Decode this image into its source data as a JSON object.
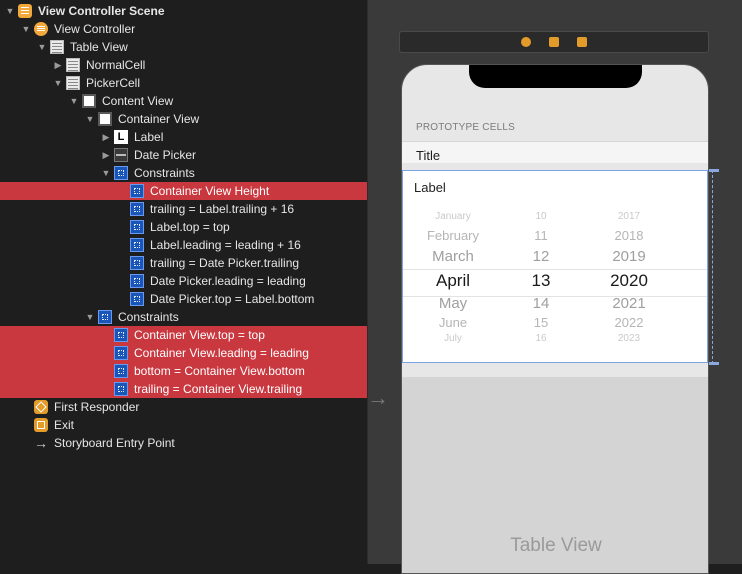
{
  "outline": {
    "rows": [
      {
        "level": 0,
        "disc": "open",
        "icon": "scene",
        "icon_name": "scene-icon",
        "label": "View Controller Scene",
        "bold": true,
        "selected": false
      },
      {
        "level": 1,
        "disc": "open",
        "icon": "vc",
        "icon_name": "view-controller-icon",
        "label": "View Controller",
        "selected": false
      },
      {
        "level": 2,
        "disc": "open",
        "icon": "table",
        "icon_name": "table-view-icon",
        "label": "Table View",
        "selected": false
      },
      {
        "level": 3,
        "disc": "closed",
        "icon": "table",
        "icon_name": "table-cell-icon",
        "label": "NormalCell",
        "selected": false
      },
      {
        "level": 3,
        "disc": "open",
        "icon": "table",
        "icon_name": "table-cell-icon",
        "label": "PickerCell",
        "selected": false
      },
      {
        "level": 4,
        "disc": "open",
        "icon": "view",
        "icon_name": "view-icon",
        "label": "Content View",
        "selected": false
      },
      {
        "level": 5,
        "disc": "open",
        "icon": "view",
        "icon_name": "view-icon",
        "label": "Container View",
        "selected": false
      },
      {
        "level": 6,
        "disc": "closed",
        "icon": "label",
        "icon_name": "label-icon",
        "icon_text": "L",
        "label": "Label",
        "selected": false
      },
      {
        "level": 6,
        "disc": "closed",
        "icon": "picker",
        "icon_name": "date-picker-icon",
        "label": "Date Picker",
        "selected": false
      },
      {
        "level": 6,
        "disc": "open",
        "icon": "cons",
        "icon_name": "constraints-icon",
        "label": "Constraints",
        "selected": false
      },
      {
        "level": 7,
        "disc": "none",
        "icon": "cons",
        "icon_name": "constraint-icon",
        "label": "Container View Height",
        "selected": true
      },
      {
        "level": 7,
        "disc": "none",
        "icon": "cons",
        "icon_name": "constraint-icon",
        "label": "trailing = Label.trailing + 16",
        "selected": false
      },
      {
        "level": 7,
        "disc": "none",
        "icon": "cons",
        "icon_name": "constraint-icon",
        "label": "Label.top = top",
        "selected": false
      },
      {
        "level": 7,
        "disc": "none",
        "icon": "cons",
        "icon_name": "constraint-icon",
        "label": "Label.leading = leading + 16",
        "selected": false
      },
      {
        "level": 7,
        "disc": "none",
        "icon": "cons",
        "icon_name": "constraint-icon",
        "label": "trailing = Date Picker.trailing",
        "selected": false
      },
      {
        "level": 7,
        "disc": "none",
        "icon": "cons",
        "icon_name": "constraint-icon",
        "label": "Date Picker.leading = leading",
        "selected": false
      },
      {
        "level": 7,
        "disc": "none",
        "icon": "cons",
        "icon_name": "constraint-icon",
        "label": "Date Picker.top = Label.bottom",
        "selected": false
      },
      {
        "level": 5,
        "disc": "open",
        "icon": "cons",
        "icon_name": "constraints-icon",
        "label": "Constraints",
        "selected": false
      },
      {
        "level": 6,
        "disc": "none",
        "icon": "cons",
        "icon_name": "constraint-icon",
        "label": "Container View.top = top",
        "selected": true
      },
      {
        "level": 6,
        "disc": "none",
        "icon": "cons",
        "icon_name": "constraint-icon",
        "label": "Container View.leading = leading",
        "selected": true
      },
      {
        "level": 6,
        "disc": "none",
        "icon": "cons",
        "icon_name": "constraint-icon",
        "label": "bottom = Container View.bottom",
        "selected": true
      },
      {
        "level": 6,
        "disc": "none",
        "icon": "cons",
        "icon_name": "constraint-icon",
        "label": "trailing = Container View.trailing",
        "selected": true
      },
      {
        "level": 1,
        "disc": "none",
        "icon": "first",
        "icon_name": "first-responder-icon",
        "label": "First Responder",
        "selected": false
      },
      {
        "level": 1,
        "disc": "none",
        "icon": "exit",
        "icon_name": "exit-icon",
        "label": "Exit",
        "selected": false
      },
      {
        "level": 1,
        "disc": "none",
        "icon": "arrow",
        "icon_name": "entry-point-arrow-icon",
        "icon_text": "→",
        "label": "Storyboard Entry Point",
        "selected": false
      }
    ]
  },
  "canvas": {
    "prototype_header": "PROTOTYPE CELLS",
    "title_cell": "Title",
    "picker_cell_label": "Label",
    "picker": [
      {
        "month": "January",
        "day": "10",
        "year": "2017",
        "size": 10,
        "color": "#c9c9c9"
      },
      {
        "month": "February",
        "day": "11",
        "year": "2018",
        "size": 13,
        "color": "#b5b5b5"
      },
      {
        "month": "March",
        "day": "12",
        "year": "2019",
        "size": 15,
        "color": "#9f9f9f"
      },
      {
        "month": "April",
        "day": "13",
        "year": "2020",
        "size": 17,
        "color": "#1a1a1a"
      },
      {
        "month": "May",
        "day": "14",
        "year": "2021",
        "size": 15,
        "color": "#9f9f9f"
      },
      {
        "month": "June",
        "day": "15",
        "year": "2022",
        "size": 13,
        "color": "#b5b5b5"
      },
      {
        "month": "July",
        "day": "16",
        "year": "2023",
        "size": 10,
        "color": "#c9c9c9"
      }
    ],
    "table_view_label": "Table View"
  }
}
